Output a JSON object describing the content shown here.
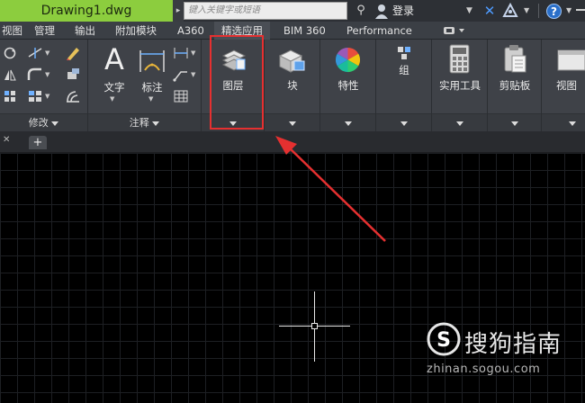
{
  "titlebar": {
    "document_title": "Drawing1.dwg",
    "search_placeholder": "键入关键字或短语",
    "login_label": "登录"
  },
  "ribbon_tabs": [
    {
      "label": "视图"
    },
    {
      "label": "管理"
    },
    {
      "label": "输出"
    },
    {
      "label": "附加模块"
    },
    {
      "label": "A360"
    },
    {
      "label": "精选应用"
    },
    {
      "label": "BIM 360"
    },
    {
      "label": "Performance"
    }
  ],
  "panels": {
    "modify": {
      "title": "修改"
    },
    "annotation": {
      "title": "注释",
      "text_label": "文字",
      "dimension_label": "标注"
    },
    "layers": {
      "label": "图层"
    },
    "block": {
      "label": "块"
    },
    "properties": {
      "label": "特性"
    },
    "group": {
      "label": "组"
    },
    "utilities": {
      "label": "实用工具"
    },
    "clipboard": {
      "label": "剪贴板"
    },
    "view": {
      "label": "视图"
    }
  },
  "watermark": {
    "logo_letter": "S",
    "brand": "搜狗指南",
    "url": "zhinan.sogou.com"
  },
  "colors": {
    "accent_green": "#8ccd3e",
    "highlight_red": "#e53030"
  }
}
